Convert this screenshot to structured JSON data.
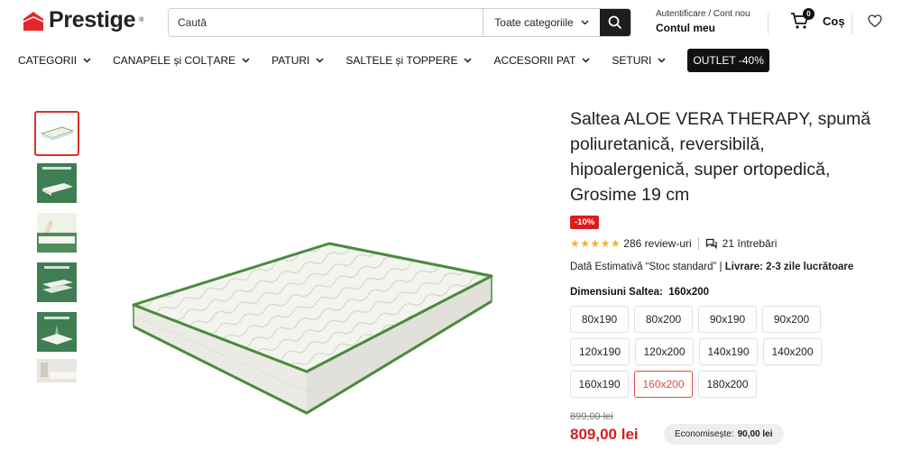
{
  "brand": {
    "name": "Prestige",
    "reg": "®",
    "color": "#e5252a"
  },
  "search": {
    "placeholder": "Caută",
    "category": "Toate categoriile"
  },
  "account": {
    "sub": "Autentificare / Cont nou",
    "main": "Contul meu"
  },
  "cart": {
    "count": "0",
    "label": "Coș"
  },
  "nav": {
    "items": [
      "CATEGORII",
      "CANAPELE și COLȚARE",
      "PATURI",
      "SALTELE și TOPPERE",
      "ACCESORII PAT",
      "SETURI"
    ],
    "outlet": "OUTLET -40%"
  },
  "product": {
    "title": "Saltea ALOE VERA THERAPY, spumă poliuretanică, reversibilă, hipoalergenică, super ortopedică, Grosime 19 cm",
    "badge": "-10%",
    "rating": 5,
    "reviews": "286 review-uri",
    "questions": "21 întrebări",
    "delivery_prefix": "Dată Estimativă “Stoc standard” | ",
    "delivery_label": "Livrare: 2-3 zile lucrătoare",
    "dimension_label": "Dimensiuni Saltea:",
    "dimension_value": "160x200",
    "sizes": [
      "80x190",
      "80x200",
      "90x190",
      "90x200",
      "120x190",
      "120x200",
      "140x190",
      "140x200",
      "160x190",
      "160x200",
      "180x200"
    ],
    "selected_size": "160x200",
    "old_price": "899,00 lei",
    "price": "809,00 lei",
    "save_label": "Economisește:",
    "save_value": "90,00 lei"
  },
  "colors": {
    "accent": "#e01b1b",
    "mattress_piping": "#4a8a3c",
    "dark": "#1d1d1d"
  }
}
